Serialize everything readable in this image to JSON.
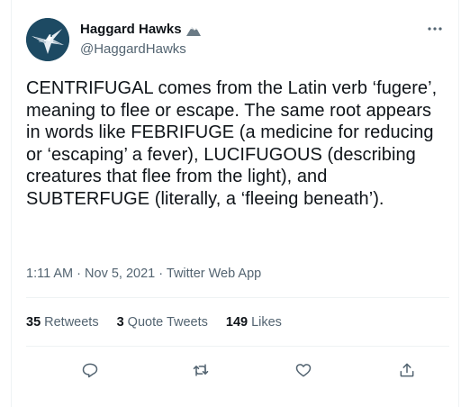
{
  "tweet": {
    "author": {
      "name": "Haggard Hawks",
      "handle": "@HaggardHawks",
      "avatar_icon": "hawk-avatar",
      "badge_icon": "mountain-emoji"
    },
    "text": "CENTRIFUGAL comes from the Latin verb ‘fugere’, meaning to flee or escape. The same root appears in words like FEBRIFUGE (a medicine for reducing or ‘escaping’ a fever), LUCIFUGOUS (describing creatures that flee from the light), and SUBTERFUGE (literally, a ‘fleeing beneath’).",
    "time": "1:11 AM",
    "separator": "·",
    "date": "Nov 5, 2021",
    "source": "Twitter Web App",
    "stats": {
      "retweets_count": "35",
      "retweets_label": "Retweets",
      "quotes_count": "3",
      "quotes_label": "Quote Tweets",
      "likes_count": "149",
      "likes_label": "Likes"
    },
    "actions": [
      "reply-icon",
      "retweet-icon",
      "like-icon",
      "share-icon"
    ]
  },
  "colors": {
    "text_primary": "#0f1419",
    "text_secondary": "#536471",
    "divider": "#eff3f4",
    "avatar_bg": "#1d4a63"
  }
}
